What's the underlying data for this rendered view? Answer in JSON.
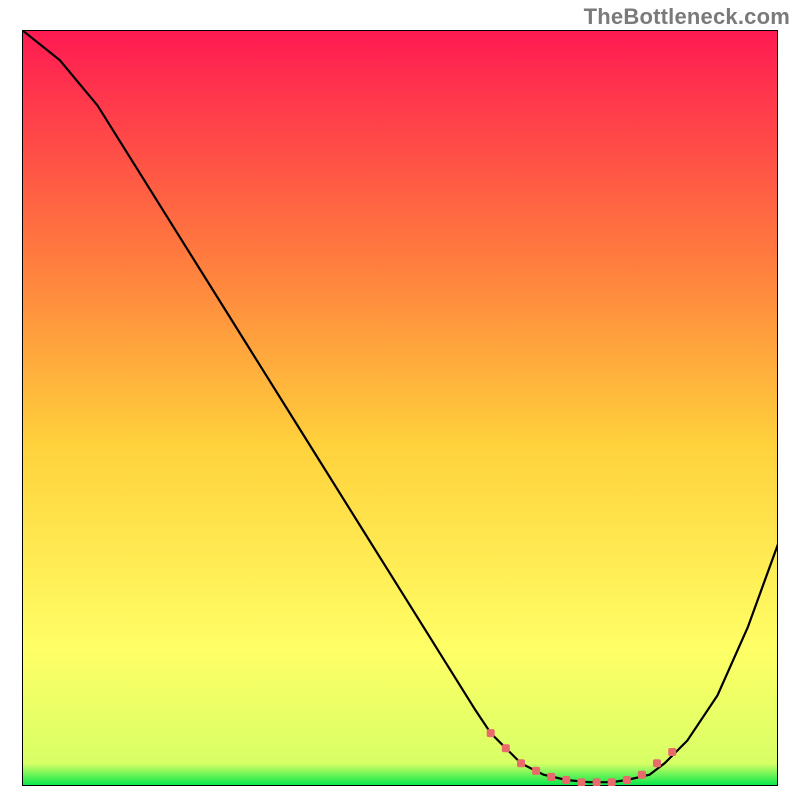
{
  "watermark": "TheBottleneck.com",
  "colors": {
    "gradient_top": "#ff1a52",
    "gradient_mid_upper": "#ff7b3e",
    "gradient_mid": "#ffd23c",
    "gradient_mid_lower": "#ffff66",
    "gradient_bottom": "#00e84a",
    "curve": "#000000",
    "marker": "#e86a6a",
    "border": "#000000"
  },
  "chart_data": {
    "type": "line",
    "title": "",
    "xlabel": "",
    "ylabel": "",
    "xlim": [
      0,
      100
    ],
    "ylim": [
      0,
      100
    ],
    "series": [
      {
        "name": "bottleneck-curve",
        "x": [
          0,
          5,
          10,
          15,
          20,
          25,
          30,
          35,
          40,
          45,
          50,
          55,
          60,
          62,
          64,
          66,
          69,
          72,
          75,
          78,
          80,
          83,
          85,
          88,
          92,
          96,
          100
        ],
        "y": [
          100,
          96,
          90,
          82,
          74,
          66,
          58,
          50,
          42,
          34,
          26,
          18,
          10,
          7,
          5,
          3,
          1.5,
          0.8,
          0.5,
          0.5,
          0.8,
          1.5,
          3,
          6,
          12,
          21,
          32
        ]
      }
    ],
    "highlighted_range": {
      "name": "optimal-zone-markers",
      "x": [
        62,
        64,
        66,
        68,
        70,
        72,
        74,
        76,
        78,
        80,
        82,
        84,
        86
      ],
      "y": [
        7,
        5,
        3,
        2,
        1.2,
        0.8,
        0.5,
        0.5,
        0.5,
        0.8,
        1.5,
        3,
        4.5
      ]
    }
  }
}
